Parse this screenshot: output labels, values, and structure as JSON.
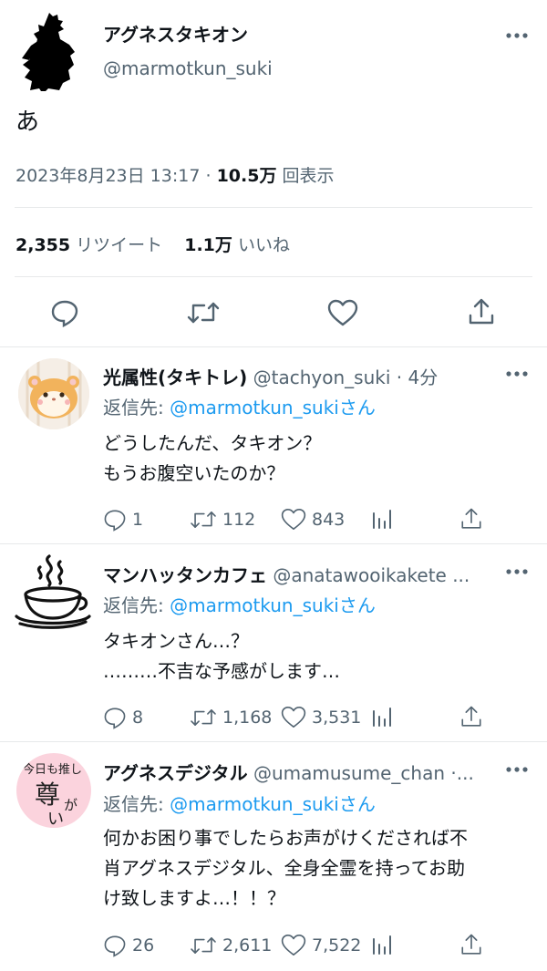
{
  "main_tweet": {
    "display_name": "アグネスタキオン",
    "handle": "@marmotkun_suki",
    "text": "あ",
    "timestamp": "2023年8月23日 13:17",
    "separator": "·",
    "views_count": "10.5万",
    "views_label": "回表示",
    "retweets_count": "2,355",
    "retweets_label": "リツイート",
    "likes_count": "1.1万",
    "likes_label": "いいね"
  },
  "replies": [
    {
      "display_name": "光属性(タキトレ)",
      "handle_time": "@tachyon_suki · 4分",
      "reply_to_prefix": "返信先:",
      "reply_to_handle": "@marmotkun_sukiさん",
      "lines": [
        "どうしたんだ、タキオン？",
        "もうお腹空いたのか？"
      ],
      "replies_count": "1",
      "retweets_count": "112",
      "likes_count": "843"
    },
    {
      "display_name": "マンハッタンカフェ",
      "handle_time": "@anatawooikakete ...",
      "reply_to_prefix": "返信先:",
      "reply_to_handle": "@marmotkun_sukiさん",
      "lines": [
        "タキオンさん…？",
        "………不吉な予感がします…"
      ],
      "replies_count": "8",
      "retweets_count": "1,168",
      "likes_count": "3,531"
    },
    {
      "display_name": "アグネスデジタル",
      "handle_time": "@umamusume_chan ·...",
      "reply_to_prefix": "返信先:",
      "reply_to_handle": "@marmotkun_sukiさん",
      "lines": [
        "何かお困り事でしたらお声がけくだされば不",
        "肖アグネスデジタル、全身全霊を持ってお助",
        "け致しますよ…！！？"
      ],
      "replies_count": "26",
      "retweets_count": "2,611",
      "likes_count": "7,522",
      "avatar_text": [
        "今日も推し",
        "尊",
        "が",
        "い"
      ]
    }
  ],
  "icons": {
    "more": "more-dots-icon",
    "reply": "reply-bubble-icon",
    "retweet": "retweet-icon",
    "like": "heart-icon",
    "share": "share-upload-icon",
    "analytics": "analytics-bars-icon"
  },
  "colors": {
    "text": "#0f1419",
    "secondary": "#536471",
    "link": "#1d9bf0",
    "divider": "#e7e9ea"
  }
}
